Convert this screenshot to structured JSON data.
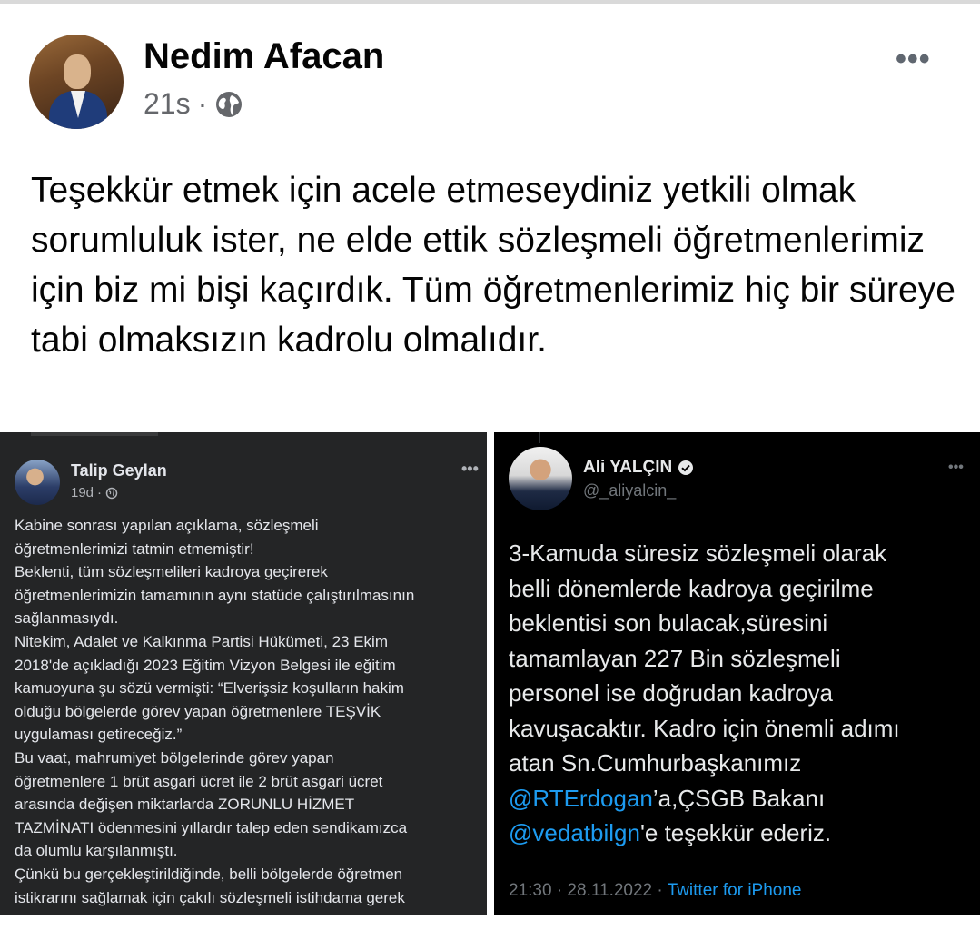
{
  "post": {
    "author": "Nedim Afacan",
    "time": "21s",
    "separator": "·",
    "privacy_icon": "globe-icon",
    "more_icon": "•••",
    "text": "Teşekkür etmek için acele etmeseydiniz yetkili olmak sorumluluk ister, ne elde ettik sözleşmeli öğretmenlerimiz için biz mi bişi kaçırdık. Tüm öğretmenlerimiz hiç bir süreye tabi olmaksızın kadrolu olmalıdır."
  },
  "left_screenshot": {
    "author": "Talip Geylan",
    "time": "19d",
    "separator": "·",
    "more_icon": "•••",
    "lines": [
      "Kabine sonrası yapılan açıklama, sözleşmeli",
      "öğretmenlerimizi tatmin etmemiştir!",
      "Beklenti, tüm sözleşmelileri kadroya geçirerek",
      "öğretmenlerimizin tamamının aynı statüde çalıştırılmasının",
      "sağlanmasıydı.",
      "Nitekim, Adalet ve Kalkınma Partisi Hükümeti, 23 Ekim",
      "2018'de açıkladığı 2023 Eğitim Vizyon Belgesi ile eğitim",
      "kamuoyuna şu sözü vermişti: “Elverişsiz koşulların hakim",
      "olduğu bölgelerde görev yapan öğretmenlere TEŞVİK",
      "uygulaması getireceğiz.”",
      "Bu vaat, mahrumiyet bölgelerinde görev yapan",
      "öğretmenlere 1 brüt asgari ücret ile 2 brüt asgari ücret",
      "arasında değişen miktarlarda ZORUNLU HİZMET",
      "TAZMİNATI ödenmesini yıllardır talep eden sendikamızca",
      "da olumlu karşılanmıştı.",
      "Çünkü bu gerçekleştirildiğinde, belli bölgelerde öğretmen",
      "istikrarını sağlamak için çakılı sözleşmeli istihdama gerek"
    ]
  },
  "right_screenshot": {
    "author": "Ali YALÇIN",
    "handle": "@_aliyalcin_",
    "more_icon": "•••",
    "lines": [
      "3-Kamuda süresiz sözleşmeli olarak",
      "belli dönemlerde kadroya geçirilme",
      "beklentisi son bulacak,süresini",
      "tamamlayan 227 Bin sözleşmeli",
      "personel ise doğrudan kadroya",
      "kavuşacaktır. Kadro için önemli adımı",
      "atan Sn.Cumhurbaşkanımız"
    ],
    "mention1": "@RTErdogan",
    "after_mention1": "’a,ÇSGB Bakanı",
    "mention2": "@vedatbilgn",
    "after_mention2": "'e teşekkür ederiz.",
    "timestamp": "21:30 · 28.11.2022 · ",
    "source": "Twitter for iPhone"
  }
}
